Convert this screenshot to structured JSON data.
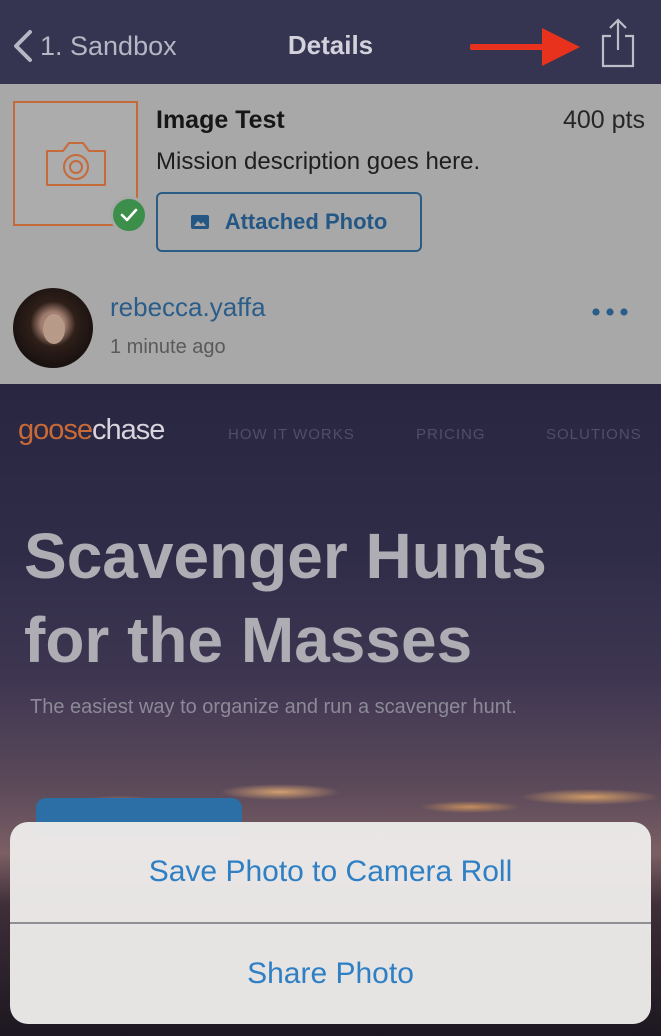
{
  "navbar": {
    "back_label": "1. Sandbox",
    "title": "Details",
    "share_icon": "share-icon",
    "arrow_color": "#e8321e"
  },
  "mission": {
    "title": "Image Test",
    "points": "400 pts",
    "description": "Mission description goes here.",
    "attachment_label": "Attached Photo",
    "status_icon": "check-icon",
    "accent_color": "#c56a3b"
  },
  "submission": {
    "username": "rebecca.yaffa",
    "timestamp": "1 minute ago"
  },
  "photo": {
    "logo_part1": "goose",
    "logo_part2": "chase",
    "nav_items": [
      "HOW IT WORKS",
      "PRICING",
      "SOLUTIONS"
    ],
    "hero_line1": "Scavenger Hunts",
    "hero_line2": "for the Masses",
    "hero_subtitle": "The easiest way to organize and run a scavenger hunt."
  },
  "action_sheet": {
    "items": [
      "Save Photo to Camera Roll",
      "Share Photo"
    ],
    "text_color": "#2f7fc4"
  }
}
